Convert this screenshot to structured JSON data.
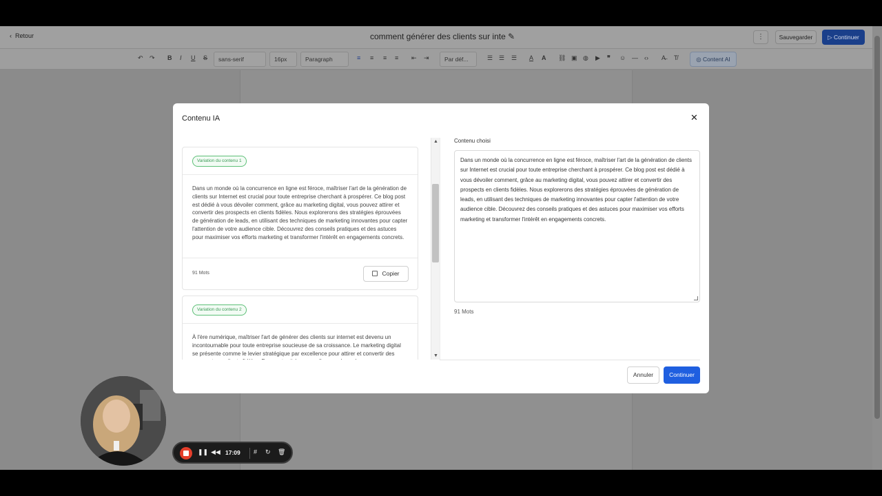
{
  "editor": {
    "back_label": "Retour",
    "doc_title": "comment générer des clients sur inte",
    "more_icon": "more-vertical-icon",
    "save_label": "Sauvegarder",
    "continue_label": "Continuer"
  },
  "toolbar": {
    "font": "sans-serif",
    "size": "16px",
    "block": "Paragraph",
    "align_select": "Par déf...",
    "content_ai": "Content AI"
  },
  "modal": {
    "title": "Contenu IA",
    "variations": [
      {
        "label": "Variation du contenu 1",
        "text": "Dans un monde où la concurrence en ligne est féroce, maîtriser l'art de la génération de clients sur Internet est crucial pour toute entreprise cherchant à prospérer. Ce blog post est dédié à vous dévoiler comment, grâce au marketing digital, vous pouvez attirer et convertir des prospects en clients fidèles. Nous explorerons des stratégies éprouvées de génération de leads, en utilisant des techniques de marketing innovantes pour capter l'attention de votre audience cible. Découvrez des conseils pratiques et des astuces pour maximiser vos efforts marketing et transformer l'intérêt en engagements concrets.",
        "words": "91 Mots",
        "copy_label": "Copier"
      },
      {
        "label": "Variation du contenu 2",
        "text": "À l'ère numérique, maîtriser l'art de générer des clients sur internet est devenu un incontournable pour toute entreprise soucieuse de sa croissance. Le marketing digital se présente comme le levier stratégique par excellence pour attirer et convertir des prospects en clients fidèles. Dans cet article, nous allons explorer des"
      }
    ],
    "chosen_label": "Contenu choisi",
    "chosen_text": "Dans un monde où la concurrence en ligne est féroce, maîtriser l'art de la génération de clients sur Internet est crucial pour toute entreprise cherchant à prospérer. Ce blog post est dédié à vous dévoiler comment, grâce au marketing digital, vous pouvez attirer et convertir des prospects en clients fidèles. Nous explorerons des stratégies éprouvées de génération de leads, en utilisant des techniques de marketing innovantes pour capter l'attention de votre audience cible. Découvrez des conseils pratiques et des astuces pour maximiser vos efforts marketing et transformer l'intérêt en engagements concrets.",
    "chosen_words": "91 Mots",
    "cancel_label": "Annuler",
    "continue_label": "Continuer"
  },
  "recorder": {
    "time": "17:09"
  }
}
